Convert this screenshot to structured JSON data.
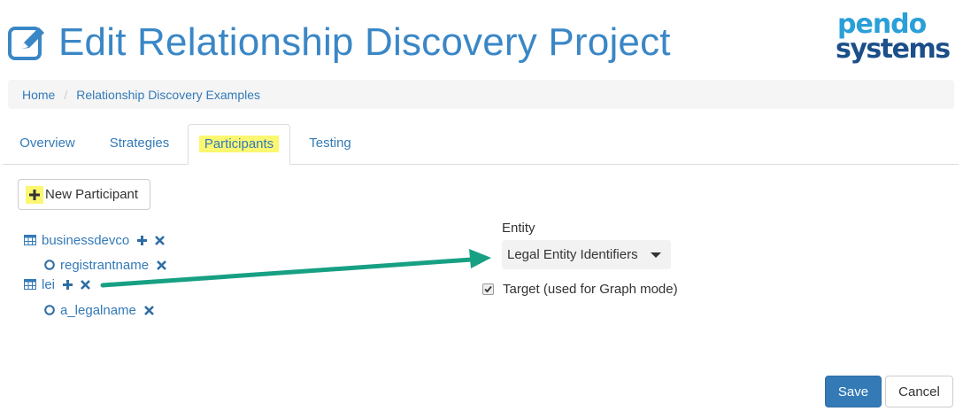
{
  "header": {
    "title": "Edit Relationship Discovery Project",
    "title_icon": "edit-icon",
    "logo": {
      "line1": "pendo",
      "line2": "systems"
    }
  },
  "breadcrumb": {
    "items": [
      "Home",
      "Relationship Discovery Examples"
    ]
  },
  "tabs": [
    {
      "label": "Overview",
      "active": false
    },
    {
      "label": "Strategies",
      "active": false
    },
    {
      "label": "Participants",
      "active": true
    },
    {
      "label": "Testing",
      "active": false
    }
  ],
  "toolbar": {
    "new_participant_label": "New Participant",
    "new_participant_icon": "plus-icon"
  },
  "participants": [
    {
      "name": "businessdevco",
      "icon": "table-icon",
      "children": [
        {
          "name": "registrantname",
          "icon": "circle-icon"
        }
      ]
    },
    {
      "name": "lei",
      "icon": "table-icon",
      "children": [
        {
          "name": "a_legalname",
          "icon": "circle-icon"
        }
      ]
    }
  ],
  "details": {
    "entity_label": "Entity",
    "entity_selected": "Legal Entity Identifiers",
    "target_label": "Target (used for Graph mode)",
    "target_checked": true
  },
  "footer": {
    "save_label": "Save",
    "cancel_label": "Cancel"
  },
  "colors": {
    "link": "#337ab7",
    "title": "#3a87c6",
    "highlight": "#fbf770",
    "arrow": "#17a083",
    "primary": "#337ab7"
  }
}
